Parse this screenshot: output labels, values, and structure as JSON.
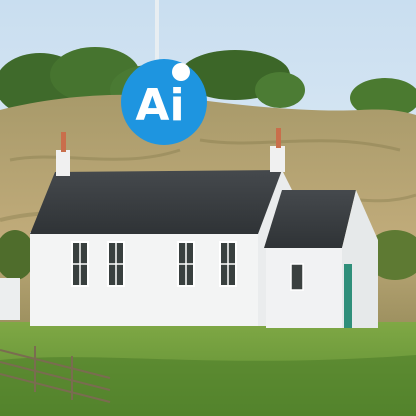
{
  "badge": {
    "text": "Ai",
    "icon": "ai-logo-icon",
    "color": "#1e95e0"
  },
  "scene": {
    "description_tags": [
      "sky",
      "hill",
      "trees",
      "cottage",
      "meadow",
      "fence"
    ],
    "colors": {
      "sky": "#dbeaf6",
      "hill": "#b9a77a",
      "grass": "#6f9a3d",
      "roof": "#3a3f44",
      "walls": "#f3f4f4",
      "door": "#2f8f7a"
    }
  }
}
